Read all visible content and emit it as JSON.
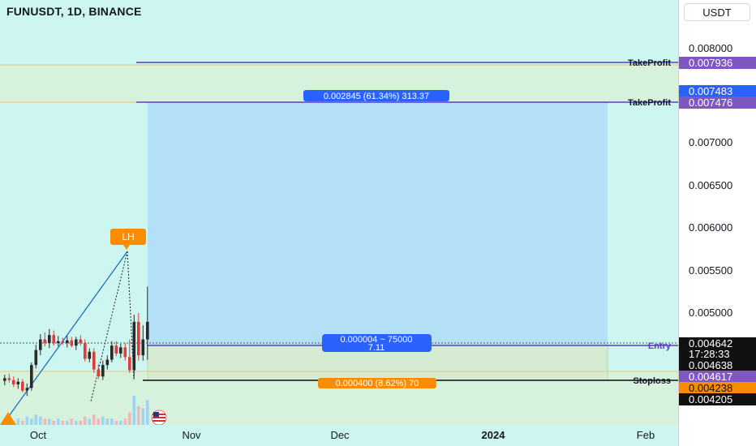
{
  "symbol_title": "FUNUSDT, 1D, BINANCE",
  "currency_button": "USDT",
  "colors": {
    "background": "#ccf6ef",
    "up_candle": "#2a2a2a",
    "down_candle": "#e03b3b",
    "target_zone": "#b3e0f7",
    "stop_zone": "#d6f2dd",
    "takeprofit_line": "#5b3fbf",
    "pivot_line": "#1565c0",
    "label_blue": "#2962ff",
    "label_orange": "#fb8c00",
    "label_purple": "#7e57c2"
  },
  "price_axis": {
    "ticks": [
      "0.008000",
      "0.007000",
      "0.006500",
      "0.006000",
      "0.005500",
      "0.005000"
    ]
  },
  "price_tags": {
    "takeprofit_1": "0.007936",
    "takeprofit_2_upper": "0.007483",
    "takeprofit_2": "0.007476",
    "current_price": "0.004642",
    "countdown": "17:28:33",
    "entry_price": "0.004638",
    "entry_line": "0.004617",
    "orange_level": "0.004238",
    "stop_price": "0.004205"
  },
  "time_axis": {
    "labels": [
      "Oct",
      "Nov",
      "Dec",
      "2024",
      "Feb"
    ]
  },
  "annotations": {
    "takeprofit_label": "TakeProfit",
    "entry_label": "Entry",
    "stoploss_label": "Stoploss",
    "pivot_label": "LH",
    "target_box": "0.002845 (61.34%) 313.37",
    "position_box_line1": "0.000004 ~ 75000",
    "position_box_line2": "7.11",
    "stop_box": "0.000400 (8.62%) 70"
  },
  "chart_data": {
    "type": "candlestick",
    "symbol": "FUNUSDT",
    "interval": "1D",
    "exchange": "BINANCE",
    "y_range": [
      0.0038,
      0.0083
    ],
    "series": [
      {
        "name": "FUNUSDT",
        "values": [
          [
            0.00423,
            0.0043,
            0.00418,
            0.00426
          ],
          [
            0.00426,
            0.00431,
            0.00421,
            0.00424
          ],
          [
            0.00424,
            0.00428,
            0.00416,
            0.00419
          ],
          [
            0.00419,
            0.00426,
            0.00414,
            0.00422
          ],
          [
            0.00422,
            0.00425,
            0.0041,
            0.00412
          ],
          [
            0.00412,
            0.0042,
            0.00406,
            0.00415
          ],
          [
            0.00415,
            0.00444,
            0.00412,
            0.00441
          ],
          [
            0.00441,
            0.00464,
            0.00437,
            0.00458
          ],
          [
            0.00458,
            0.00476,
            0.00452,
            0.0047
          ],
          [
            0.0047,
            0.00478,
            0.00462,
            0.00466
          ],
          [
            0.00466,
            0.00482,
            0.0046,
            0.00475
          ],
          [
            0.00475,
            0.0048,
            0.00463,
            0.00466
          ],
          [
            0.00466,
            0.00474,
            0.00462,
            0.00468
          ],
          [
            0.00468,
            0.00472,
            0.00464,
            0.00466
          ],
          [
            0.00466,
            0.00474,
            0.00461,
            0.00469
          ],
          [
            0.00469,
            0.00473,
            0.00461,
            0.00463
          ],
          [
            0.00463,
            0.00473,
            0.00458,
            0.0047
          ],
          [
            0.0047,
            0.00475,
            0.00463,
            0.00466
          ],
          [
            0.00466,
            0.0047,
            0.00445,
            0.00448
          ],
          [
            0.00448,
            0.0046,
            0.00444,
            0.00456
          ],
          [
            0.00456,
            0.0046,
            0.00432,
            0.00436
          ],
          [
            0.00436,
            0.00442,
            0.00425,
            0.00428
          ],
          [
            0.00428,
            0.00446,
            0.00424,
            0.00441
          ],
          [
            0.00441,
            0.00452,
            0.00436,
            0.00447
          ],
          [
            0.00447,
            0.00468,
            0.00444,
            0.00463
          ],
          [
            0.00463,
            0.00468,
            0.00451,
            0.00454
          ],
          [
            0.00454,
            0.00465,
            0.00449,
            0.00461
          ],
          [
            0.00461,
            0.00466,
            0.00446,
            0.0045
          ],
          [
            0.0045,
            0.0047,
            0.00432,
            0.00435
          ],
          [
            0.00435,
            0.00498,
            0.00426,
            0.0049
          ],
          [
            0.0049,
            0.005,
            0.00446,
            0.00452
          ],
          [
            0.00452,
            0.00486,
            0.00446,
            0.0047
          ],
          [
            0.0047,
            0.0053,
            0.00447,
            0.0049
          ]
        ]
      },
      {
        "name": "Volume",
        "values": [
          3,
          2,
          2,
          3,
          2,
          4,
          3,
          5,
          4,
          3,
          3,
          2,
          3,
          2,
          2,
          3,
          2,
          2,
          4,
          3,
          5,
          3,
          4,
          3,
          3,
          2,
          2,
          3,
          6,
          14,
          9,
          8,
          12
        ]
      }
    ],
    "levels": {
      "takeprofit_1": 0.007936,
      "takeprofit_2": 0.007476,
      "entry": 0.004617,
      "stoploss": 0.004205
    },
    "x_labels": [
      "Oct",
      "Nov",
      "Dec",
      "2024",
      "Feb"
    ]
  }
}
